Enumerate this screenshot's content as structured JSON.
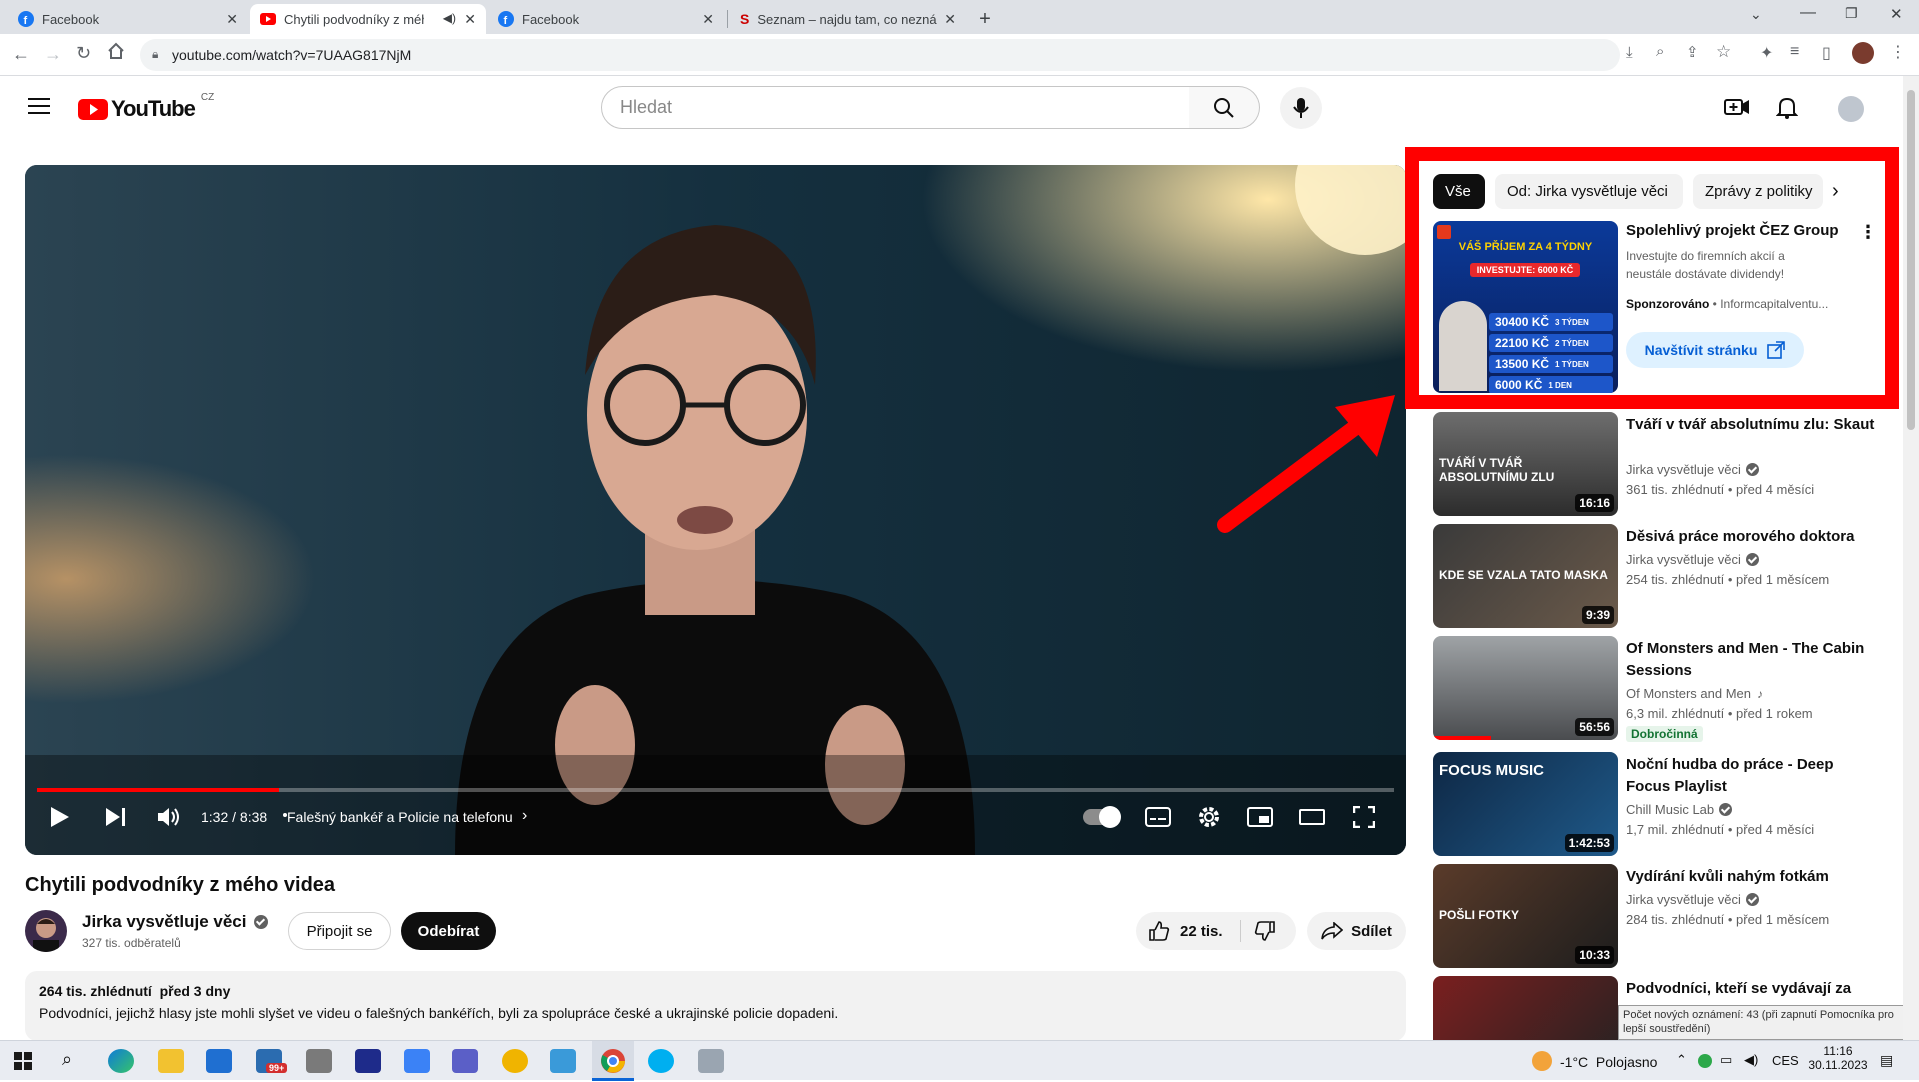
{
  "browser": {
    "tabs": [
      {
        "title": "Facebook"
      },
      {
        "title": "Chytili podvodníky z mého videa"
      },
      {
        "title": "Facebook"
      },
      {
        "title": "Seznam – najdu tam, co neznám"
      }
    ],
    "url": "youtube.com/watch?v=7UAAG817NjM"
  },
  "yt": {
    "logo_text": "YouTube",
    "region": "CZ",
    "search_placeholder": "Hledat"
  },
  "player": {
    "time": "1:32 / 8:38",
    "chapter": "Falešný bankéř a Policie na telefonu",
    "progress": 0.178
  },
  "video": {
    "title": "Chytili podvodníky z mého videa",
    "channel": "Jirka vysvětluje věci",
    "subscribers": "327 tis. odběratelů",
    "join_label": "Připojit se",
    "subscribe_label": "Odebírat",
    "likes": "22 tis.",
    "share_label": "Sdílet",
    "desc_meta": "264 tis. zhlédnutí  před 3 dny",
    "desc_text": "Podvodníci, jejichž hlasy jste mohli slyšet ve videu o falešných bankéřích, byli za spolupráce české a ukrajinské policie dopadeni."
  },
  "chips": [
    "Vše",
    "Od: Jirka vysvětluje věci",
    "Zprávy z politiky"
  ],
  "ad": {
    "title": "Spolehlivý projekt ČEZ Group",
    "desc": "Investujte do firemních akcií a neustále dostávate dividendy!",
    "sponsored": "Sponzorováno",
    "advertiser": "Informcapitalventu...",
    "cta": "Navštívit stránku",
    "thumb_heading": "VÁŠ PŘÍJEM ZA 4 TÝDNY",
    "thumb_sub": "INVESTUJTE: 6000 KČ",
    "thumb_rows": [
      {
        "amount": "30400 KČ",
        "period": "3 TÝDEN"
      },
      {
        "amount": "22100 KČ",
        "period": "2 TÝDEN"
      },
      {
        "amount": "13500 KČ",
        "period": "1 TÝDEN"
      },
      {
        "amount": "6000 KČ",
        "period": "1 DEN"
      }
    ]
  },
  "recommendations": [
    {
      "title": "Tváří v tvář absolutnímu zlu: Skaut",
      "channel": "Jirka vysvětluje věci",
      "verified": true,
      "meta": "361 tis. zhlédnutí • před 4 měsíci",
      "duration": "16:16",
      "thumb_text": "TVÁŘÍ V TVÁŘ ABSOLUTNÍMU ZLU"
    },
    {
      "title": "Děsivá práce morového doktora",
      "channel": "Jirka vysvětluje věci",
      "verified": true,
      "meta": "254 tis. zhlédnutí • před 1 měsícem",
      "duration": "9:39",
      "thumb_text": "KDE SE VZALA TATO MASKA"
    },
    {
      "title": "Of Monsters and Men - The Cabin Sessions",
      "channel": "Of Monsters and Men",
      "verified": false,
      "meta": "6,3 mil. zhlédnutí • před 1 rokem",
      "badge": "Dobročinná",
      "duration": "56:56"
    },
    {
      "title": "Noční hudba do práce - Deep Focus Playlist",
      "channel": "Chill Music Lab",
      "verified": true,
      "meta": "1,7 mil. zhlédnutí • před 4 měsíci",
      "duration": "1:42:53",
      "thumb_text": "FOCUS MUSIC"
    },
    {
      "title": "Vydírání kvůli nahým fotkám",
      "channel": "Jirka vysvětluje věci",
      "verified": true,
      "meta": "284 tis. zhlédnutí • před 1 měsícem",
      "duration": "10:33",
      "thumb_text": "POŠLI FOTKY"
    },
    {
      "title": "Podvodníci, kteří se vydávají za"
    }
  ],
  "tooltip": "Počet nových oznámení: 43 (při zapnutí Pomocníka pro lepší soustředění)",
  "taskbar": {
    "weather": "-1°C  Polojasno",
    "lang": "CES",
    "time": "11:16",
    "date": "30.11.2023",
    "badge": "99+"
  },
  "colors": {
    "highlight": "#ff0000",
    "yt_red": "#ff0000",
    "progress": "#ff0000"
  }
}
